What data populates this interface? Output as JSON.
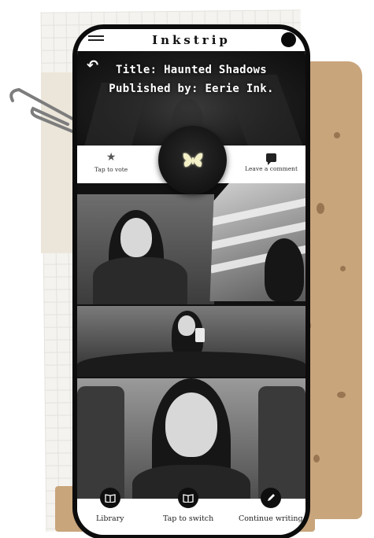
{
  "app": {
    "name": "Inkstrip"
  },
  "hero": {
    "title_line1": "Title: Haunted Shadows",
    "title_line2": "Published by: Eerie Ink."
  },
  "actions": {
    "vote_label": "Tap to vote",
    "comment_label": "Leave a comment"
  },
  "bottom_nav": {
    "library_label": "Library",
    "switch_label": "Tap to switch",
    "continue_label": "Continue writing"
  },
  "icons": {
    "menu": "hamburger-icon",
    "profile": "profile-avatar",
    "back": "back-arrow-icon",
    "vote": "star-icon",
    "comment": "comment-icon",
    "brand": "butterfly-icon",
    "library": "book-icon",
    "switch": "book-icon",
    "write": "pencil-icon"
  },
  "colors": {
    "primary": "#0f0f0f",
    "background": "#ffffff",
    "kraft": "#c9a57c",
    "butterfly_glow": "#f3f0c8"
  }
}
